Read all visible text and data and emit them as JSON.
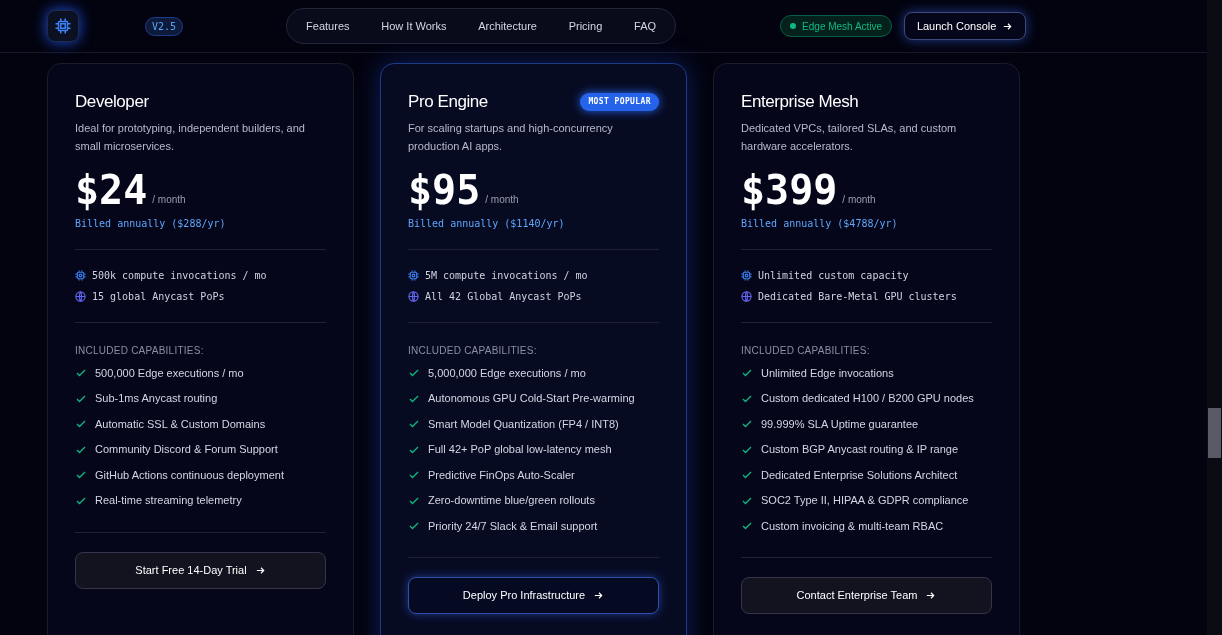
{
  "header": {
    "version": "V2.5",
    "nav": [
      {
        "label": "Features"
      },
      {
        "label": "How It Works"
      },
      {
        "label": "Architecture"
      },
      {
        "label": "Pricing"
      },
      {
        "label": "FAQ"
      }
    ],
    "status": {
      "label": "Edge Mesh Active",
      "color": "#10b981"
    },
    "cta": "Launch Console"
  },
  "plans": [
    {
      "name": "Developer",
      "featured": false,
      "description": "Ideal for prototyping, independent builders, and small microservices.",
      "price": "$24",
      "period": "/ month",
      "billing": "Billed annually ($288/yr)",
      "limits": [
        {
          "kind": "compute",
          "text": "500k compute invocations / mo"
        },
        {
          "kind": "network",
          "text": "15 global Anycast PoPs"
        }
      ],
      "capabilities_heading": "INCLUDED CAPABILITIES:",
      "capabilities": [
        "500,000 Edge executions / mo",
        "Sub-1ms Anycast routing",
        "Automatic SSL & Custom Domains",
        "Community Discord & Forum Support",
        "GitHub Actions continuous deployment",
        "Real-time streaming telemetry"
      ],
      "button": "Start Free 14-Day Trial"
    },
    {
      "name": "Pro Engine",
      "featured": true,
      "badge": "MOST POPULAR",
      "description": "For scaling startups and high-concurrency production AI apps.",
      "price": "$95",
      "period": "/ month",
      "billing": "Billed annually ($1140/yr)",
      "limits": [
        {
          "kind": "compute",
          "text": "5M compute invocations / mo"
        },
        {
          "kind": "network",
          "text": "All 42 Global Anycast PoPs"
        }
      ],
      "capabilities_heading": "INCLUDED CAPABILITIES:",
      "capabilities": [
        "5,000,000 Edge executions / mo",
        "Autonomous GPU Cold-Start Pre-warming",
        "Smart Model Quantization (FP4 / INT8)",
        "Full 42+ PoP global low-latency mesh",
        "Predictive FinOps Auto-Scaler",
        "Zero-downtime blue/green rollouts",
        "Priority 24/7 Slack & Email support"
      ],
      "button": "Deploy Pro Infrastructure"
    },
    {
      "name": "Enterprise Mesh",
      "featured": false,
      "description": "Dedicated VPCs, tailored SLAs, and custom hardware accelerators.",
      "price": "$399",
      "period": "/ month",
      "billing": "Billed annually ($4788/yr)",
      "limits": [
        {
          "kind": "compute",
          "text": "Unlimited custom capacity"
        },
        {
          "kind": "network",
          "text": "Dedicated Bare-Metal GPU clusters"
        }
      ],
      "capabilities_heading": "INCLUDED CAPABILITIES:",
      "capabilities": [
        "Unlimited Edge invocations",
        "Custom dedicated H100 / B200 GPU nodes",
        "99.999% SLA Uptime guarantee",
        "Custom BGP Anycast routing & IP range",
        "Dedicated Enterprise Solutions Architect",
        "SOC2 Type II, HIPAA & GDPR compliance",
        "Custom invoicing & multi-team RBAC"
      ],
      "button": "Contact Enterprise Team"
    }
  ]
}
